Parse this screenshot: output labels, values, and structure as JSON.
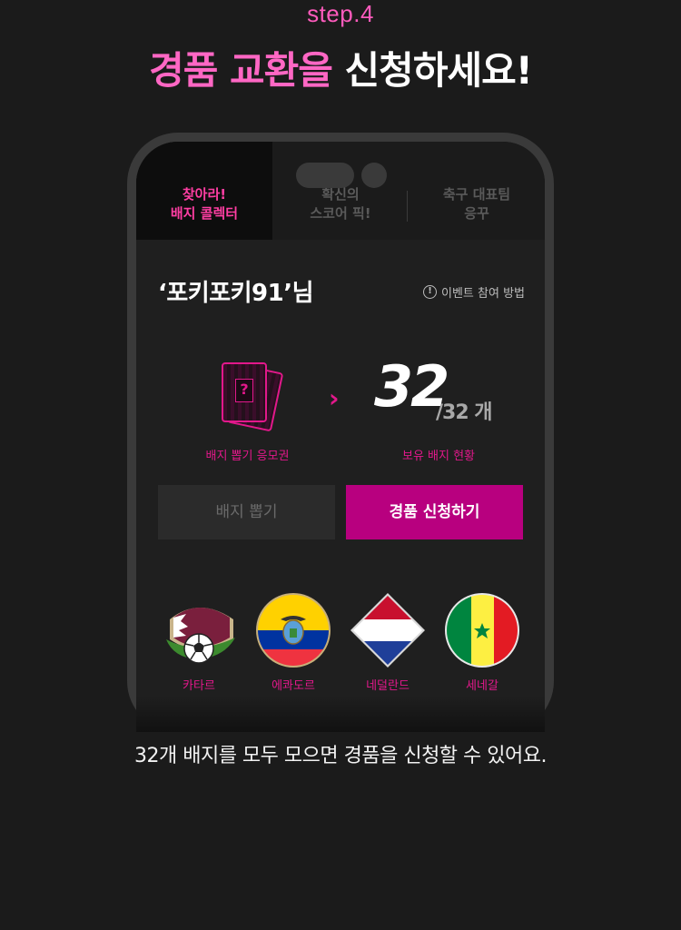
{
  "step": "step.4",
  "headline": {
    "pink": "경품 교환을",
    "white": "신청하세요!"
  },
  "tabs": [
    {
      "line1": "찾아라!",
      "line2": "배지 콜렉터",
      "active": true
    },
    {
      "line1": "확신의",
      "line2": "스코어 픽!",
      "active": false
    },
    {
      "line1": "축구 대표팀",
      "line2": "응꾸",
      "active": false
    }
  ],
  "user": {
    "name": "‘포키포키91’님"
  },
  "howto_label": "이벤트 참여 방법",
  "ticket": {
    "caption": "배지 뽑기 응모권",
    "card_mark": "?"
  },
  "owned": {
    "count": "32",
    "total": "/32 개",
    "caption": "보유 배지 현황"
  },
  "buttons": {
    "draw": "배지 뽑기",
    "apply": "경품 신청하기"
  },
  "badges": [
    {
      "name": "카타르",
      "icon": "qatar-flag-icon"
    },
    {
      "name": "에콰도르",
      "icon": "ecuador-flag-icon"
    },
    {
      "name": "네덜란드",
      "icon": "netherlands-flag-icon"
    },
    {
      "name": "세네갈",
      "icon": "senegal-flag-icon"
    }
  ],
  "description": "32개 배지를 모두 모으면 경품을 신청할 수 있어요.",
  "colors": {
    "accent_pink": "#e2188b",
    "headline_pink": "#ff67c4",
    "button_magenta": "#b8007f",
    "background": "#1b1b1b"
  }
}
